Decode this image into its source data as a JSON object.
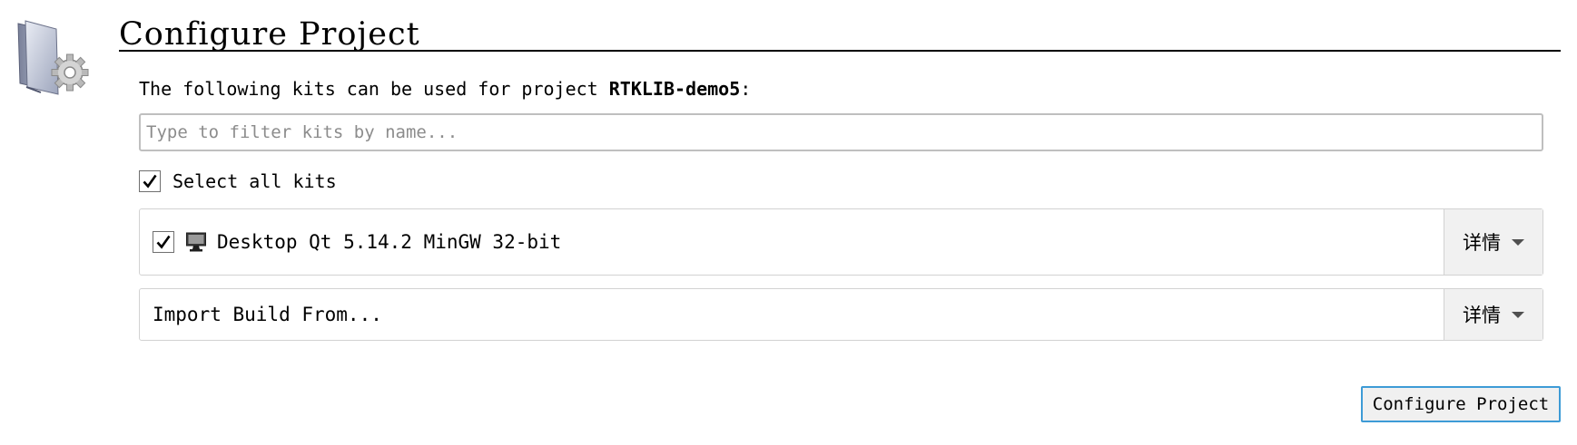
{
  "header": {
    "title": "Configure Project",
    "icon": "folder-gear-icon"
  },
  "kits_intro": {
    "prefix": "The following kits can be used for project ",
    "project_name": "RTKLIB-demo5",
    "suffix": ":"
  },
  "filter": {
    "placeholder": "Type to filter kits by name...",
    "value": ""
  },
  "select_all": {
    "label": "Select all kits",
    "checked": true,
    "check_glyph": "check-icon"
  },
  "kits": [
    {
      "name": "Desktop Qt 5.14.2 MinGW 32-bit",
      "checked": true,
      "icon": "monitor-icon",
      "details_label": "详情"
    }
  ],
  "import_build": {
    "label": "Import Build From...",
    "details_label": "详情"
  },
  "footer": {
    "configure_button_label": "Configure Project"
  },
  "colors": {
    "accent_border": "#3d9bd6",
    "details_background": "#f1f1f1",
    "row_border": "#d2d2d2",
    "placeholder_text": "#8c8c8c"
  }
}
